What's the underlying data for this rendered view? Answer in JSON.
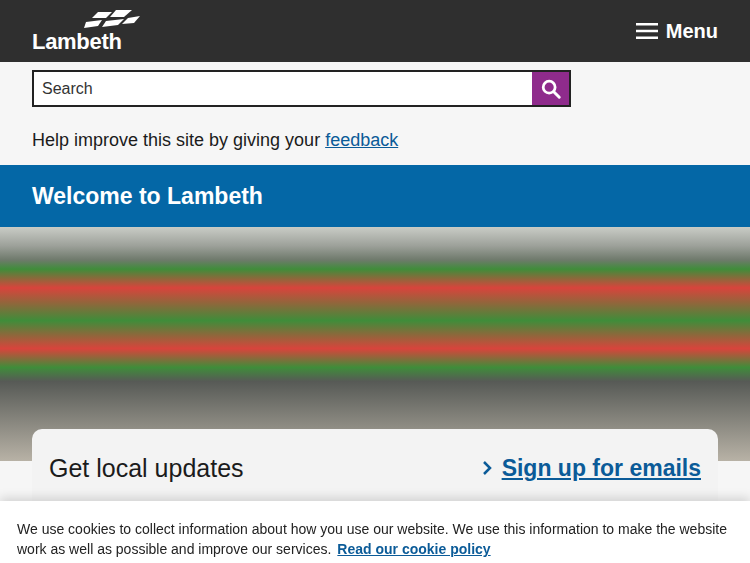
{
  "header": {
    "logo": "Lambeth",
    "menu_label": "Menu"
  },
  "search": {
    "placeholder": "Search"
  },
  "feedback": {
    "text": "Help improve this site by giving your",
    "link": "feedback"
  },
  "banner": {
    "title": "Welcome to Lambeth"
  },
  "updates": {
    "title": "Get local updates",
    "link": "Sign up for emails"
  },
  "cookie_notice": {
    "text": "We use cookies to collect information about how you use our website. We use this information to make the website work as well as possible and improve our services.",
    "link": "Read our cookie policy"
  }
}
